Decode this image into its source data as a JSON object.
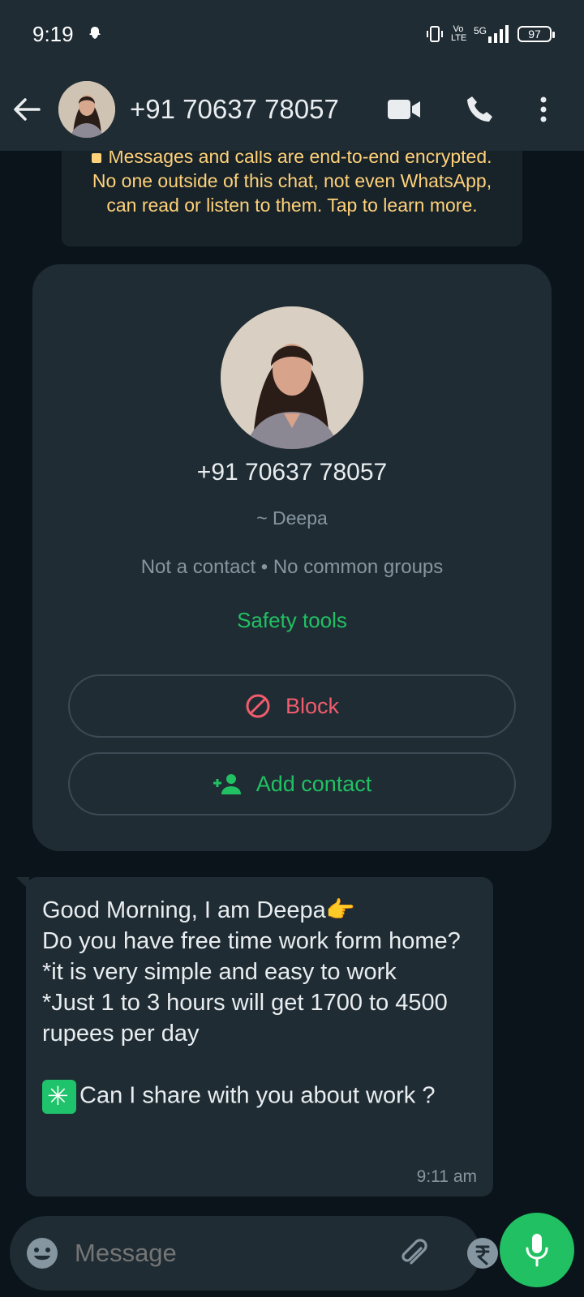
{
  "status_bar": {
    "time": "9:19",
    "battery": "97",
    "network": "5G",
    "volte": "Vo LTE"
  },
  "header": {
    "title": "+91 70637 78057"
  },
  "encryption_notice": {
    "text": "Messages and calls are end-to-end encrypted. No one outside of this chat, not even WhatsApp, can read or listen to them. Tap to learn more."
  },
  "contact_card": {
    "phone": "+91 70637 78057",
    "name": "~ Deepa",
    "meta": "Not a contact • No common groups",
    "safety_tools": "Safety tools",
    "block_label": "Block",
    "add_contact_label": "Add contact"
  },
  "message": {
    "text": "Good Morning, I am Deepa👉\nDo you have free time work form home?\n*it is very simple and easy to work\n*Just 1 to 3 hours will get 1700 to 4500 rupees per day\n",
    "question": "Can I share with you about work ?",
    "time": "9:11 am"
  },
  "composer": {
    "placeholder": "Message"
  },
  "colors": {
    "accent": "#21c063",
    "danger": "#f15c6d",
    "notice": "#ffd279",
    "bubble": "#1f2c34",
    "background": "#0b141a"
  }
}
